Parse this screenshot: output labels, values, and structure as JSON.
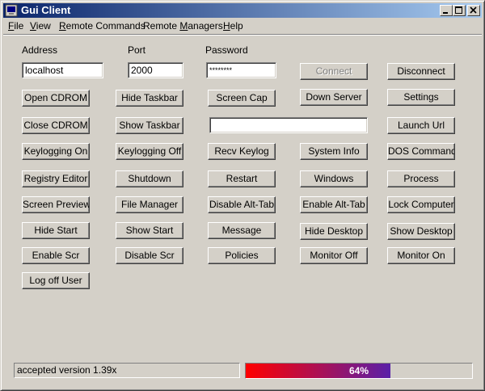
{
  "window": {
    "title": "Gui Client"
  },
  "menu": [
    {
      "pre": "",
      "ul": "F",
      "post": "ile"
    },
    {
      "pre": "",
      "ul": "V",
      "post": "iew"
    },
    {
      "pre": "",
      "ul": "R",
      "post": "emote Commands"
    },
    {
      "pre": "Remote ",
      "ul": "M",
      "post": "anagers"
    },
    {
      "pre": "",
      "ul": "H",
      "post": "elp"
    }
  ],
  "connection": {
    "address_label": "Address",
    "port_label": "Port",
    "password_label": "Password",
    "address_value": "localhost",
    "port_value": "2000",
    "password_value": "********",
    "connect": "Connect",
    "disconnect": "Disconnect"
  },
  "url_value": "",
  "buttons": {
    "open_cdrom": "Open CDROM",
    "hide_taskbar": "Hide Taskbar",
    "screen_cap": "Screen Cap",
    "down_server": "Down Server",
    "settings": "Settings",
    "close_cdrom": "Close CDROM",
    "show_taskbar": "Show Taskbar",
    "launch_url": "Launch Url",
    "keylogging_on": "Keylogging On",
    "keylogging_off": "Keylogging Off",
    "recv_keylog": "Recv Keylog",
    "system_info": "System Info",
    "dos_command": "DOS Command",
    "registry_editor": "Registry Editor",
    "shutdown": "Shutdown",
    "restart": "Restart",
    "windows": "Windows",
    "process": "Process",
    "screen_preview": "Screen Preview",
    "file_manager": "File Manager",
    "disable_alt_tab": "Disable Alt-Tab",
    "enable_alt_tab": "Enable Alt-Tab",
    "lock_computer": "Lock Computer",
    "hide_start": "Hide Start",
    "show_start": "Show Start",
    "message": "Message",
    "hide_desktop": "Hide Desktop",
    "show_desktop": "Show Desktop",
    "enable_scr": "Enable Scr",
    "disable_scr": "Disable Scr",
    "policies": "Policies",
    "monitor_off": "Monitor Off",
    "monitor_on": "Monitor On",
    "log_off_user": "Log off User"
  },
  "status": {
    "text": "accepted version 1.39x",
    "progress_percent": 64,
    "progress_label": "64%"
  },
  "colors": {
    "title_start": "#0a246a",
    "title_end": "#a6caf0",
    "progress_start": "#ff0000",
    "progress_end": "#5a20a8"
  }
}
